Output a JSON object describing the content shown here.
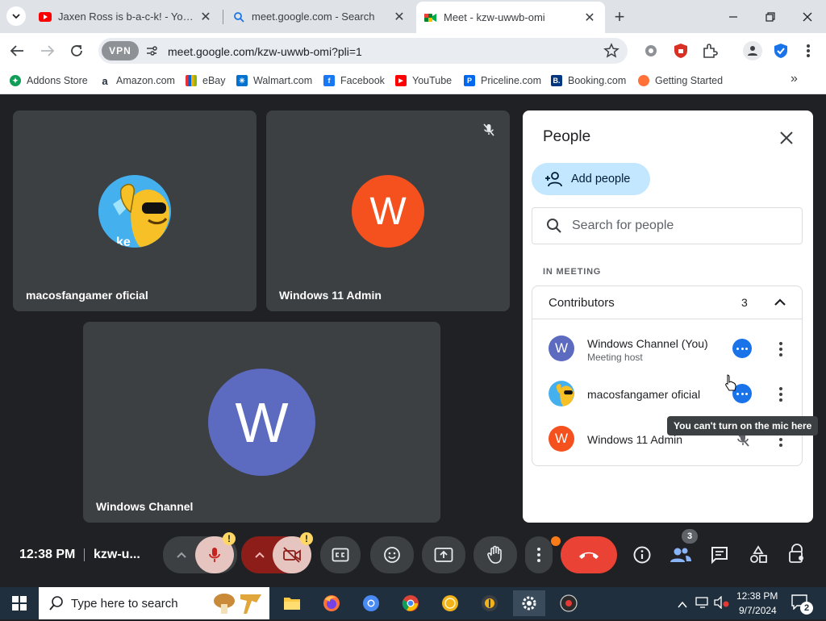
{
  "browser": {
    "tabs": [
      {
        "title": "Jaxen Ross is b-a-c-k! - YouTube",
        "favicon": "youtube-icon"
      },
      {
        "title": "meet.google.com - Search",
        "favicon": "search-icon"
      },
      {
        "title": "Meet - kzw-uwwb-omi",
        "favicon": "meet-icon",
        "active": true
      }
    ],
    "new_tab_label": "+",
    "url": "meet.google.com/kzw-uwwb-omi?pli=1",
    "vpn_label": "VPN",
    "bookmarks": [
      {
        "label": "Addons Store",
        "icon": "addons-icon",
        "color": "#0f9d58"
      },
      {
        "label": "Amazon.com",
        "icon": "amazon-icon",
        "color": "#232f3e"
      },
      {
        "label": "eBay",
        "icon": "ebay-icon",
        "color": "#e53238"
      },
      {
        "label": "Walmart.com",
        "icon": "walmart-icon",
        "color": "#0071ce"
      },
      {
        "label": "Facebook",
        "icon": "facebook-icon",
        "color": "#1877f2"
      },
      {
        "label": "YouTube",
        "icon": "youtube-icon",
        "color": "#ff0000"
      },
      {
        "label": "Priceline.com",
        "icon": "priceline-icon",
        "color": "#0068ef"
      },
      {
        "label": "Booking.com",
        "icon": "booking-icon",
        "color": "#003580"
      },
      {
        "label": "Getting Started",
        "icon": "firefox-icon",
        "color": "#ff7139"
      }
    ],
    "bookmarks_overflow": "»"
  },
  "meet": {
    "tiles": [
      {
        "name": "macosfangamer oficial",
        "avatar": "cartoon-avatar"
      },
      {
        "name": "Windows 11 Admin",
        "initial": "W",
        "color": "#f4511e",
        "muted": true
      },
      {
        "name": "Windows Channel",
        "initial": "W",
        "color": "#5c6bc0"
      }
    ],
    "time": "12:38 PM",
    "meeting_code": "kzw-u...",
    "people_badge": "3",
    "colors": {
      "end_call": "#ea4335",
      "accent": "#1a73e8",
      "mic_off": "#e6c4c0"
    }
  },
  "people_panel": {
    "title": "People",
    "add_people_label": "Add people",
    "search_placeholder": "Search for people",
    "section_label": "IN MEETING",
    "group_label": "Contributors",
    "group_count": "3",
    "participants": [
      {
        "name": "Windows Channel (You)",
        "subtitle": "Meeting host",
        "initial": "W",
        "color": "#5c6bc0"
      },
      {
        "name": "macosfangamer oficial",
        "subtitle": "",
        "avatar": "cartoon-avatar"
      },
      {
        "name": "Windows 11 Admin",
        "subtitle": "",
        "initial": "W",
        "color": "#f4511e"
      }
    ],
    "tooltip": "You can't turn on the mic here"
  },
  "taskbar": {
    "search_placeholder": "Type here to search",
    "time": "12:38 PM",
    "date": "9/7/2024",
    "notification_count": "2"
  }
}
